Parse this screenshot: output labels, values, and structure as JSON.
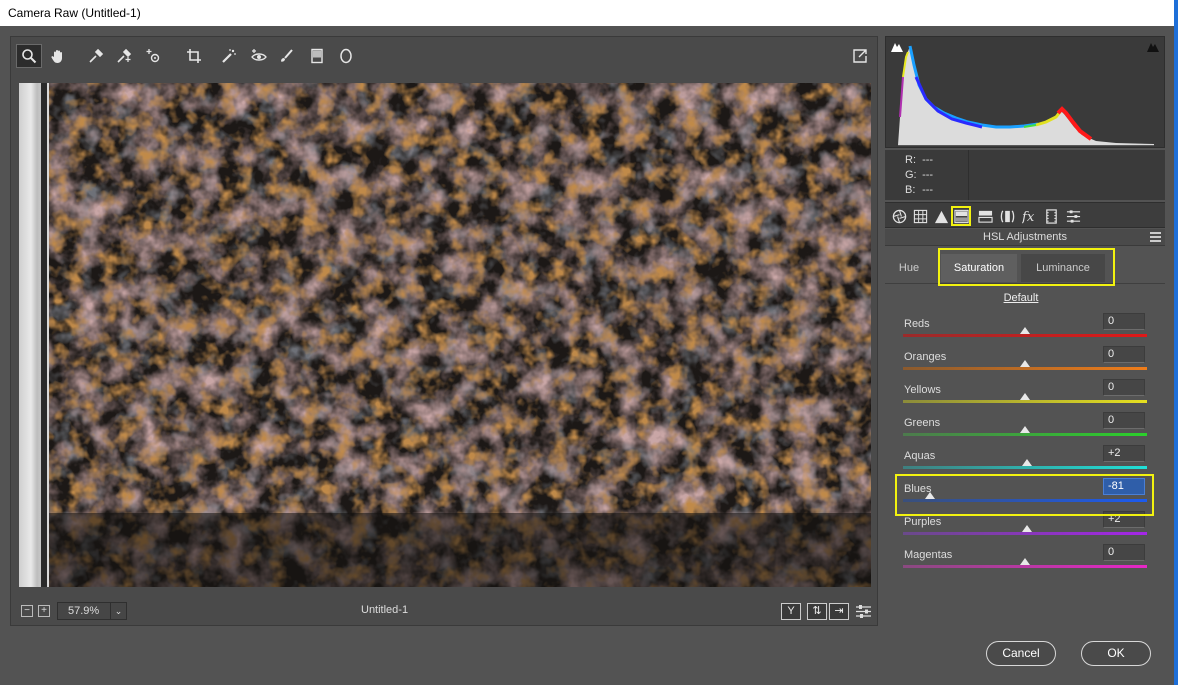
{
  "window": {
    "title": "Camera Raw (Untitled-1)"
  },
  "toolbar": {
    "tools": [
      {
        "icon": "zoom-icon"
      },
      {
        "icon": "hand-icon"
      },
      {
        "icon": "white-balance-icon"
      },
      {
        "icon": "color-sampler-icon"
      },
      {
        "icon": "targeted-adjustment-icon"
      },
      {
        "icon": "crop-icon"
      },
      {
        "icon": "spot-removal-icon"
      },
      {
        "icon": "red-eye-icon"
      },
      {
        "icon": "adjustment-brush-icon"
      },
      {
        "icon": "graduated-filter-icon"
      },
      {
        "icon": "radial-filter-icon"
      }
    ],
    "open_preferences_icon": "export-icon"
  },
  "status": {
    "zoom_value": "57.9%",
    "filename": "Untitled-1",
    "view_buttons": [
      "Y",
      "⇅",
      "⇥"
    ]
  },
  "readout": {
    "r_label": "R:",
    "g_label": "G:",
    "b_label": "B:",
    "r_value": "---",
    "g_value": "---",
    "b_value": "---"
  },
  "panel": {
    "title": "HSL Adjustments",
    "tabs": [
      "Hue",
      "Saturation",
      "Luminance"
    ],
    "selected_tab": "Saturation",
    "default_link": "Default",
    "sliders": [
      {
        "label": "Reds",
        "value": "0",
        "level": 0,
        "color_from": "#9a2b2b",
        "color_to": "#e01818"
      },
      {
        "label": "Oranges",
        "value": "0",
        "level": 0,
        "color_from": "#8a5a2e",
        "color_to": "#f07d1a"
      },
      {
        "label": "Yellows",
        "value": "0",
        "level": 0,
        "color_from": "#8b8b3a",
        "color_to": "#e6e020"
      },
      {
        "label": "Greens",
        "value": "0",
        "level": 0,
        "color_from": "#4d7a4d",
        "color_to": "#2bd12b"
      },
      {
        "label": "Aquas",
        "value": "+2",
        "level": 2,
        "color_from": "#3f7f7f",
        "color_to": "#20e0d8"
      },
      {
        "label": "Blues",
        "value": "-81",
        "level": -81,
        "color_from": "#3a4f7a",
        "color_to": "#1c5bf0"
      },
      {
        "label": "Purples",
        "value": "+2",
        "level": 2,
        "color_from": "#6a4a8a",
        "color_to": "#a526e8"
      },
      {
        "label": "Magentas",
        "value": "0",
        "level": 0,
        "color_from": "#8a4a80",
        "color_to": "#e826c8"
      }
    ]
  },
  "buttons": {
    "cancel": "Cancel",
    "ok": "OK"
  },
  "colors": {
    "highlight": "#f2f20f",
    "selected_field": "#2f5ea9"
  }
}
